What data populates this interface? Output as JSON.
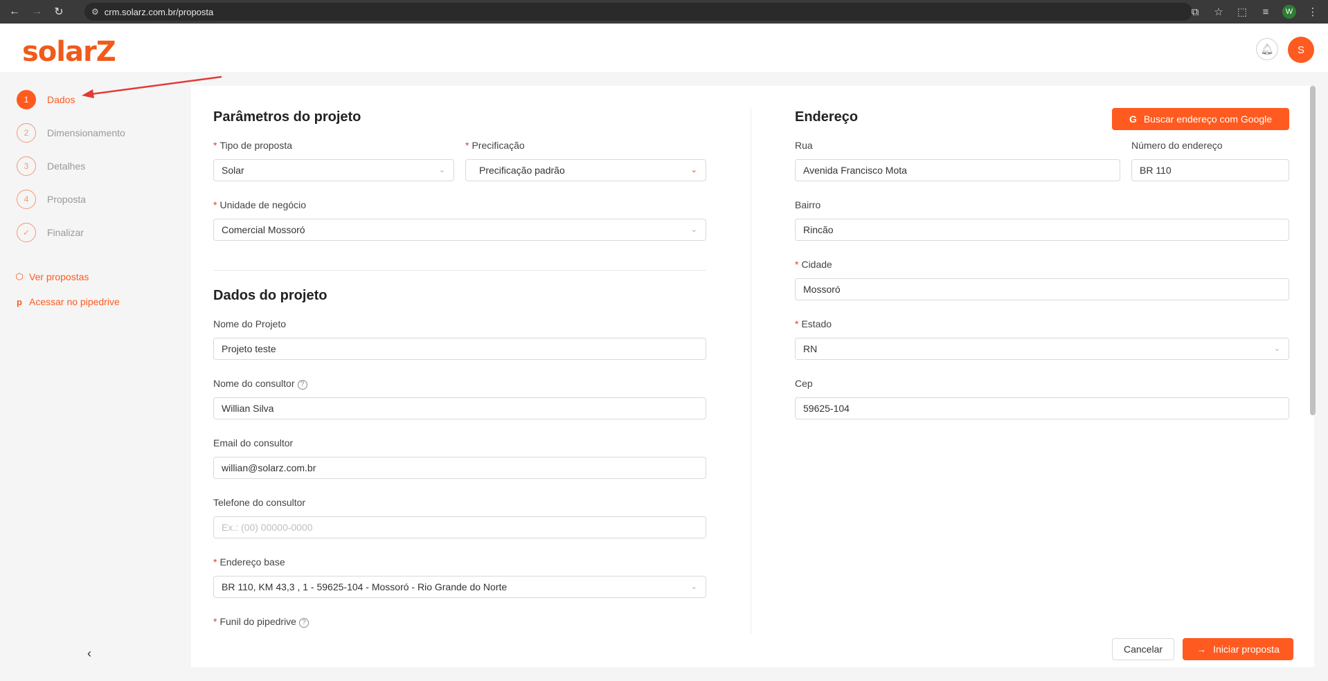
{
  "browser": {
    "url": "crm.solarz.com.br/proposta",
    "profile_initial": "W"
  },
  "header": {
    "logo_text": "solarZ",
    "avatar_initial": "S"
  },
  "sidebar": {
    "steps": [
      {
        "num": "1",
        "label": "Dados",
        "active": true
      },
      {
        "num": "2",
        "label": "Dimensionamento"
      },
      {
        "num": "3",
        "label": "Detalhes"
      },
      {
        "num": "4",
        "label": "Proposta"
      },
      {
        "num": "✓",
        "label": "Finalizar"
      }
    ],
    "links": [
      {
        "label": "Ver propostas",
        "icon": "box-icon"
      },
      {
        "label": "Acessar no pipedrive",
        "icon": "pipedrive-icon"
      }
    ]
  },
  "params": {
    "title": "Parâmetros do projeto",
    "tipo_label": "Tipo de proposta",
    "tipo_value": "Solar",
    "precificacao_label": "Precificação",
    "precificacao_value": "Precificação padrão",
    "unidade_label": "Unidade de negócio",
    "unidade_value": "Comercial Mossoró"
  },
  "projeto": {
    "title": "Dados do projeto",
    "nome_label": "Nome do Projeto",
    "nome_value": "Projeto teste",
    "consultor_label": "Nome do consultor",
    "consultor_value": "Willian Silva",
    "email_label": "Email do consultor",
    "email_value": "willian@solarz.com.br",
    "telefone_label": "Telefone do consultor",
    "telefone_placeholder": "Ex.: (00) 00000-0000",
    "endereco_base_label": "Endereço base",
    "endereco_base_value": "BR 110, KM 43,3 , 1 - 59625-104 - Mossoró - Rio Grande do Norte",
    "funil_label": "Funil do pipedrive"
  },
  "endereco": {
    "title": "Endereço",
    "google_button": "Buscar endereço com Google",
    "rua_label": "Rua",
    "rua_value": "Avenida Francisco Mota",
    "numero_label": "Número do endereço",
    "numero_value": "BR 110",
    "bairro_label": "Bairro",
    "bairro_value": "Rincão",
    "cidade_label": "Cidade",
    "cidade_value": "Mossoró",
    "estado_label": "Estado",
    "estado_value": "RN",
    "cep_label": "Cep",
    "cep_value": "59625-104"
  },
  "footer": {
    "cancel": "Cancelar",
    "start": "Iniciar proposta"
  },
  "colors": {
    "accent": "#ff5a1f",
    "required": "#e53935"
  }
}
